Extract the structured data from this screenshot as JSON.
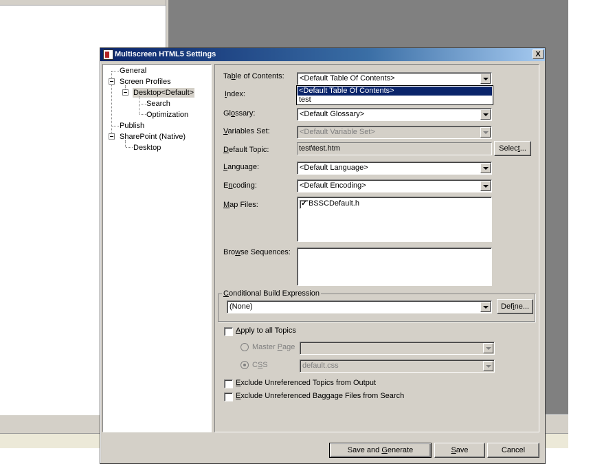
{
  "window": {
    "title": "Multiscreen HTML5 Settings",
    "close_label": "X"
  },
  "tree": {
    "general": "General",
    "screen_profiles": "Screen Profiles",
    "desktop_default": "Desktop<Default>",
    "search": "Search",
    "optimization": "Optimization",
    "publish": "Publish",
    "sharepoint": "SharePoint (Native)",
    "desktop": "Desktop"
  },
  "form": {
    "toc_label_pre": "Ta",
    "toc_label_u": "b",
    "toc_label_post": "le of Contents:",
    "toc_value": "<Default Table Of Contents>",
    "index_label_u": "I",
    "index_label_post": "ndex:",
    "glossary_label_pre": "Gl",
    "glossary_label_u": "o",
    "glossary_label_post": "ssary:",
    "glossary_value": "<Default Glossary>",
    "variables_label_u": "V",
    "variables_label_post": "ariables Set:",
    "variables_value": "<Default Variable Set>",
    "topic_label_u": "D",
    "topic_label_post": "efault Topic:",
    "topic_value": "test\\test.htm",
    "select_btn_pre": "Selec",
    "select_btn_u": "t",
    "select_btn_post": "...",
    "language_label_u": "L",
    "language_label_post": "anguage:",
    "language_value": "<Default Language>",
    "encoding_label_pre": "E",
    "encoding_label_u": "n",
    "encoding_label_post": "coding:",
    "encoding_value": "<Default Encoding>",
    "mapfiles_label_u": "M",
    "mapfiles_label_post": "ap Files:",
    "mapfile_item": "BSSCDefault.h",
    "browse_label_pre": "Bro",
    "browse_label_u": "w",
    "browse_label_post": "se Sequences:",
    "cond_group_u": "C",
    "cond_group_post": "onditional Build Expression",
    "cond_value": "(None)",
    "define_btn_pre": "Def",
    "define_btn_u": "i",
    "define_btn_post": "ne...",
    "apply_u": "A",
    "apply_post": "pply to all Topics",
    "master_pre": "Master ",
    "master_u": "P",
    "master_post": "age",
    "css_pre": "C",
    "css_u": "S",
    "css_post": "S",
    "css_value": "default.css",
    "exclude_topics_u": "E",
    "exclude_topics_post": "xclude Unreferenced Topics from Output",
    "exclude_baggage_u": "E",
    "exclude_baggage_post": "xclude Unreferenced Baggage Files from Search"
  },
  "dropdown": {
    "items": [
      "<Default Table Of Contents>",
      "test"
    ]
  },
  "buttons": {
    "save_generate_pre": "Save and ",
    "save_generate_u": "G",
    "save_generate_post": "enerate",
    "save_u": "S",
    "save_post": "ave",
    "cancel": "Cancel"
  },
  "colors": {
    "title_bar": "#0a246a",
    "dialog_face": "#d4d0c8",
    "selection": "#0a246a"
  }
}
